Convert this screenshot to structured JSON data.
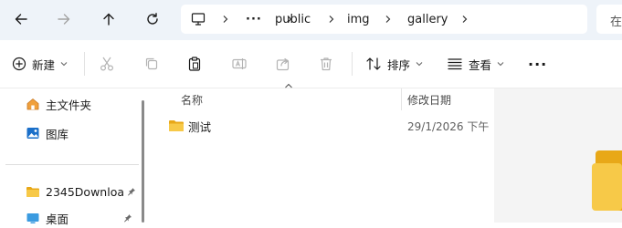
{
  "nav": {
    "back_icon": "arrow-left-icon",
    "forward_icon": "arrow-right-icon",
    "up_icon": "arrow-up-icon",
    "refresh_icon": "refresh-icon"
  },
  "address": {
    "computer_icon": "monitor-icon",
    "overflow": "···",
    "segments": [
      "public",
      "img",
      "gallery"
    ]
  },
  "search": {
    "text": "在"
  },
  "toolbar": {
    "new_label": "新建",
    "sort_label": "排序",
    "view_label": "查看",
    "more_label": "···"
  },
  "sidebar": {
    "items": [
      {
        "label": "主文件夹",
        "icon": "home-icon"
      },
      {
        "label": "图库",
        "icon": "gallery-icon"
      },
      {
        "label": "2345Downloa",
        "icon": "folder-icon",
        "pinned": true
      },
      {
        "label": "桌面",
        "icon": "desktop-icon",
        "pinned": true
      }
    ]
  },
  "file_list": {
    "columns": {
      "name": "名称",
      "modified": "修改日期"
    },
    "rows": [
      {
        "name": "测试",
        "modified": "29/1/2026 下午",
        "type": "folder"
      }
    ]
  },
  "colors": {
    "nav_background": "#eef3f9",
    "folder_yellow": "#f5c542",
    "accent_blue": "#1a6fc9"
  }
}
